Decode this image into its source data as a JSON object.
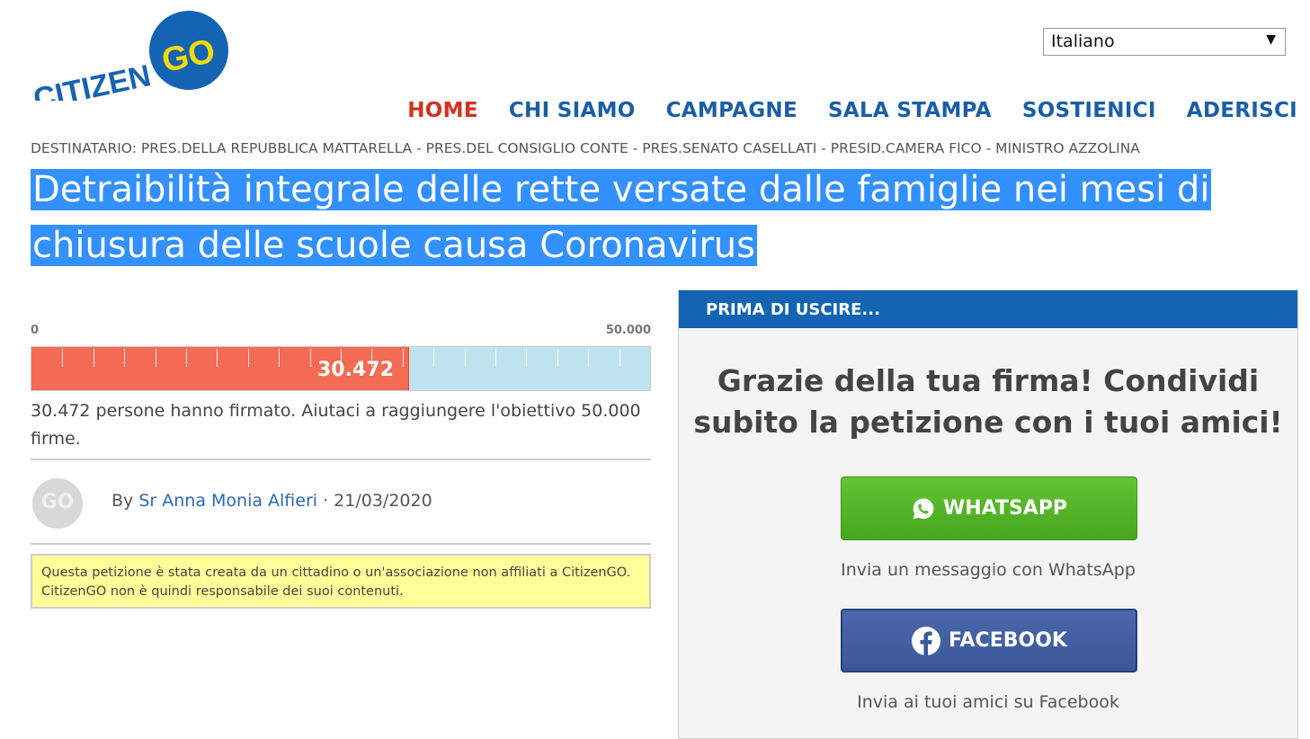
{
  "brand": {
    "part1": "CITIZEN",
    "part2": "GO"
  },
  "language_select": {
    "value": "Italiano"
  },
  "nav": {
    "items": [
      {
        "label": "HOME",
        "active": true
      },
      {
        "label": "CHI SIAMO"
      },
      {
        "label": "CAMPAGNE"
      },
      {
        "label": "SALA STAMPA"
      },
      {
        "label": "SOSTIENICI"
      },
      {
        "label": "ADERISCI"
      }
    ]
  },
  "petition": {
    "recipient": "DESTINATARIO: PRES.DELLA REPUBBLICA MATTARELLA - PRES.DEL CONSIGLIO CONTE - PRES.SENATO CASELLATI - PRESID.CAMERA FICO - MINISTRO AZZOLINA",
    "title": "Detraibilità integrale delle rette versate dalle famiglie nei mesi di chiusura delle scuole causa Coronavirus",
    "progress": {
      "min_label": "0",
      "max_label": "50.000",
      "current_label": "30.472",
      "fraction": 0.60944
    },
    "signed_text": "30.472 persone hanno firmato. Aiutaci a raggiungere l'obiettivo 50.000 firme.",
    "author": {
      "avatar_text": "GO",
      "by": "By",
      "name": "Sr Anna Monia Alfieri",
      "date": " · 21/03/2020"
    },
    "disclaimer": "Questa petizione è stata creata da un cittadino o un'associazione non affiliati a CitizenGO. CitizenGO non è quindi responsabile dei suoi contenuti."
  },
  "share_panel": {
    "header": "PRIMA DI USCIRE...",
    "heading": "Grazie della tua firma! Condividi subito la petizione con i tuoi amici!",
    "whatsapp": {
      "label": "WHATSAPP",
      "caption": "Invia un messaggio con WhatsApp"
    },
    "facebook": {
      "label": "FACEBOOK",
      "caption": "Invia ai tuoi amici su Facebook"
    }
  },
  "colors": {
    "brand_blue": "#1464b4",
    "brand_yellow": "#f5d90a",
    "nav_active": "#d6311c",
    "progress_fill": "#f26b52",
    "progress_track": "#bfe3ee",
    "whatsapp_green": "#58b52a",
    "facebook_blue": "#3b5898",
    "title_highlight": "#3390ff"
  },
  "icons": [
    "whatsapp-icon",
    "facebook-icon",
    "dropdown-arrow-icon"
  ]
}
